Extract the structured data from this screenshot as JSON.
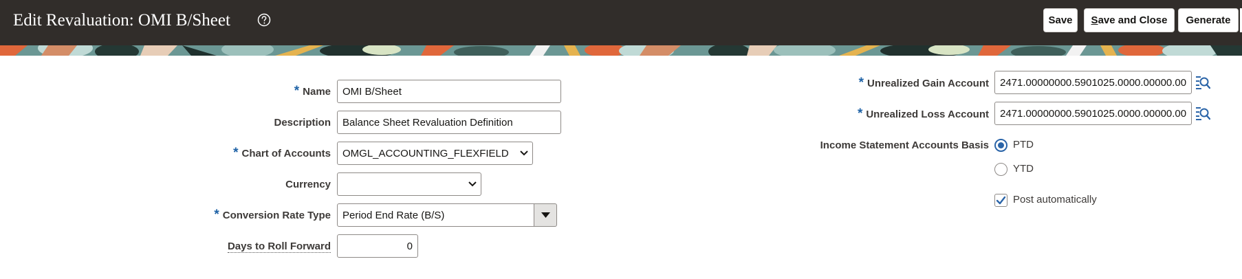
{
  "header": {
    "title": "Edit Revaluation: OMI B/Sheet",
    "help_icon": "help-circle-icon",
    "buttons": {
      "save": "Save",
      "save_and_close_mnemonic": "S",
      "save_and_close_rest": "ave and Close",
      "generate": "Generate"
    }
  },
  "form": {
    "name": {
      "label": "Name",
      "required": "*",
      "value": "OMI B/Sheet"
    },
    "description": {
      "label": "Description",
      "value": "Balance Sheet Revaluation Definition"
    },
    "chart_of_accounts": {
      "label": "Chart of Accounts",
      "required": "*",
      "value": "OMGL_ACCOUNTING_FLEXFIELD"
    },
    "currency": {
      "label": "Currency",
      "value": ""
    },
    "conversion_rate_type": {
      "label": "Conversion Rate Type",
      "required": "*",
      "value": "Period End Rate (B/S)"
    },
    "days_to_roll_forward": {
      "label": "Days to Roll Forward",
      "value": "0"
    },
    "unrealized_gain_account": {
      "label": "Unrealized Gain Account",
      "required": "*",
      "value": "2471.00000000.5901025.0000.00000.00"
    },
    "unrealized_loss_account": {
      "label": "Unrealized Loss Account",
      "required": "*",
      "value": "2471.00000000.5901025.0000.00000.00"
    },
    "income_statement_basis": {
      "label": "Income Statement Accounts Basis",
      "options": [
        "PTD",
        "YTD"
      ],
      "selected": "PTD"
    },
    "post_automatically": {
      "label": "Post automatically",
      "checked": true
    }
  },
  "colors": {
    "header_bg": "#312d2a",
    "required_marker": "#1e62a6",
    "radio_selected": "#2a64a8"
  }
}
